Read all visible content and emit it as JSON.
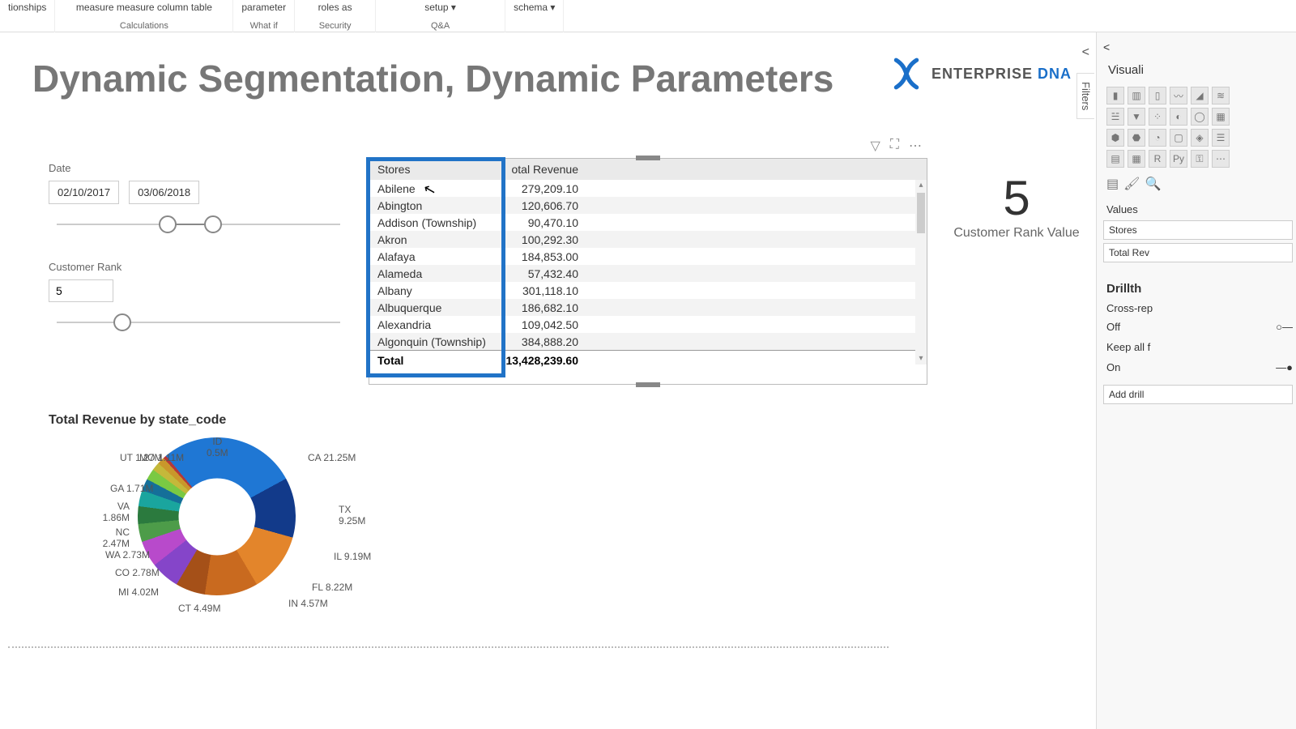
{
  "ribbon": {
    "cells": [
      {
        "top": "tionships",
        "bot": ""
      },
      {
        "top": "measure  measure  column  table",
        "bot": "Calculations"
      },
      {
        "top": "parameter",
        "bot": "What if"
      },
      {
        "top": "roles     as",
        "bot": "Security"
      },
      {
        "top": "setup           ▾",
        "bot": "Q&A"
      },
      {
        "top": "schema ▾",
        "bot": ""
      }
    ]
  },
  "title": "Dynamic Segmentation, Dynamic Parameters",
  "logo": {
    "brand": "ENTERPRISE",
    "accent": "DNA"
  },
  "slicers": {
    "date_label": "Date",
    "date_from": "02/10/2017",
    "date_to": "03/06/2018",
    "rank_label": "Customer Rank",
    "rank_value": "5"
  },
  "table": {
    "h1": "Stores",
    "h2": "otal Revenue",
    "rows": [
      {
        "c1": "Abilene",
        "c2": "279,209.10"
      },
      {
        "c1": "Abington",
        "c2": "120,606.70"
      },
      {
        "c1": "Addison (Township)",
        "c2": "90,470.10"
      },
      {
        "c1": "Akron",
        "c2": "100,292.30"
      },
      {
        "c1": "Alafaya",
        "c2": "184,853.00"
      },
      {
        "c1": "Alameda",
        "c2": "57,432.40"
      },
      {
        "c1": "Albany",
        "c2": "301,118.10"
      },
      {
        "c1": "Albuquerque",
        "c2": "186,682.10"
      },
      {
        "c1": "Alexandria",
        "c2": "109,042.50"
      },
      {
        "c1": "Algonquin (Township)",
        "c2": "384,888.20"
      }
    ],
    "total_label": "Total",
    "total_value": "13,428,239.60"
  },
  "card": {
    "value": "5",
    "label": "Customer Rank Value"
  },
  "chart_data": {
    "type": "pie",
    "title": "Total Revenue by state_code",
    "series": [
      {
        "name": "CA",
        "label": "CA 21.25M",
        "value": 21.25,
        "color": "#1f77d4"
      },
      {
        "name": "TX",
        "label": "TX 9.25M",
        "value": 9.25,
        "color": "#123a8a"
      },
      {
        "name": "IL",
        "label": "IL 9.19M",
        "value": 9.19,
        "color": "#e3852b"
      },
      {
        "name": "FL",
        "label": "FL 8.22M",
        "value": 8.22,
        "color": "#c96a1f"
      },
      {
        "name": "IN",
        "label": "IN 4.57M",
        "value": 4.57,
        "color": "#a55018"
      },
      {
        "name": "CT",
        "label": "CT 4.49M",
        "value": 4.49,
        "color": "#8545c9"
      },
      {
        "name": "MI",
        "label": "MI 4.02M",
        "value": 4.02,
        "color": "#b84acb"
      },
      {
        "name": "CO",
        "label": "CO 2.78M",
        "value": 2.78,
        "color": "#4d9c49"
      },
      {
        "name": "WA",
        "label": "WA 2.73M",
        "value": 2.73,
        "color": "#2b7a3e"
      },
      {
        "name": "NC",
        "label": "NC 2.47M",
        "value": 2.47,
        "color": "#1aa59e"
      },
      {
        "name": "VA",
        "label": "VA 1.86M",
        "value": 1.86,
        "color": "#156f99"
      },
      {
        "name": "GA",
        "label": "GA 1.71M",
        "value": 1.71,
        "color": "#7ac943"
      },
      {
        "name": "UT",
        "label": "UT 1.27M",
        "value": 1.27,
        "color": "#c4b83a"
      },
      {
        "name": "MO",
        "label": "MO 1.11M",
        "value": 1.11,
        "color": "#c9972b"
      },
      {
        "name": "ID",
        "label": "ID 0.5M",
        "value": 0.5,
        "color": "#b53838"
      }
    ]
  },
  "viz_panel": {
    "title": "Visuali",
    "values_label": "Values",
    "wells": [
      "Stores",
      "Total Rev"
    ],
    "drill_title": "Drillth",
    "cross": "Cross-rep",
    "off": "Off",
    "keep": "Keep all f",
    "on": "On",
    "add": "Add drill"
  },
  "filters_tab": "Filters"
}
